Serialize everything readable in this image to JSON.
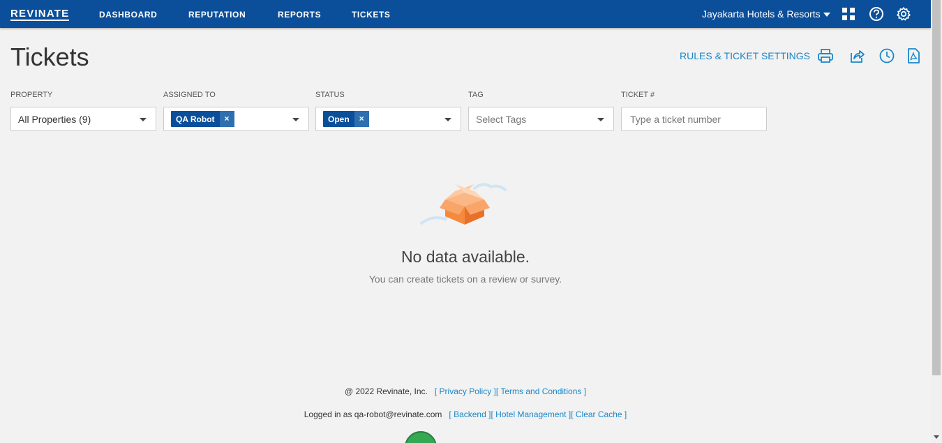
{
  "topbar": {
    "logo": "REVINATE",
    "nav": [
      "DASHBOARD",
      "REPUTATION",
      "REPORTS",
      "TICKETS"
    ],
    "hotel": "Jayakarta Hotels & Resorts",
    "icons": [
      "apps-grid-icon",
      "help-icon",
      "settings-gear-icon"
    ],
    "background": "#0b4f9a"
  },
  "header": {
    "title": "Tickets",
    "rules_link": "RULES & TICKET SETTINGS",
    "actions": [
      "print-icon",
      "share-icon",
      "history-clock-icon",
      "pdf-icon"
    ]
  },
  "filters": {
    "property": {
      "label": "PROPERTY",
      "value": "All Properties (9)"
    },
    "assigned_to": {
      "label": "ASSIGNED TO",
      "chip": "QA Robot"
    },
    "status": {
      "label": "STATUS",
      "chip": "Open"
    },
    "tag": {
      "label": "TAG",
      "placeholder": "Select Tags"
    },
    "ticket": {
      "label": "TICKET #",
      "placeholder": "Type a ticket number"
    },
    "chip_remove": "×"
  },
  "empty": {
    "title": "No data available.",
    "subtitle": "You can create tickets on a review or survey."
  },
  "footer": {
    "copyright": "@ 2022 Revinate, Inc.",
    "privacy": "[ Privacy Policy ]",
    "terms": "[ Terms and Conditions ]",
    "logged_in": "Logged in as qa-robot@revinate.com",
    "backend": "[ Backend ]",
    "hotel_mgmt": "[ Hotel Management ]",
    "clear_cache": "[ Clear Cache ]"
  },
  "colors": {
    "accent": "#1a87c9",
    "chip": "#0b4f9a",
    "box_orange": "#f58a3c"
  }
}
